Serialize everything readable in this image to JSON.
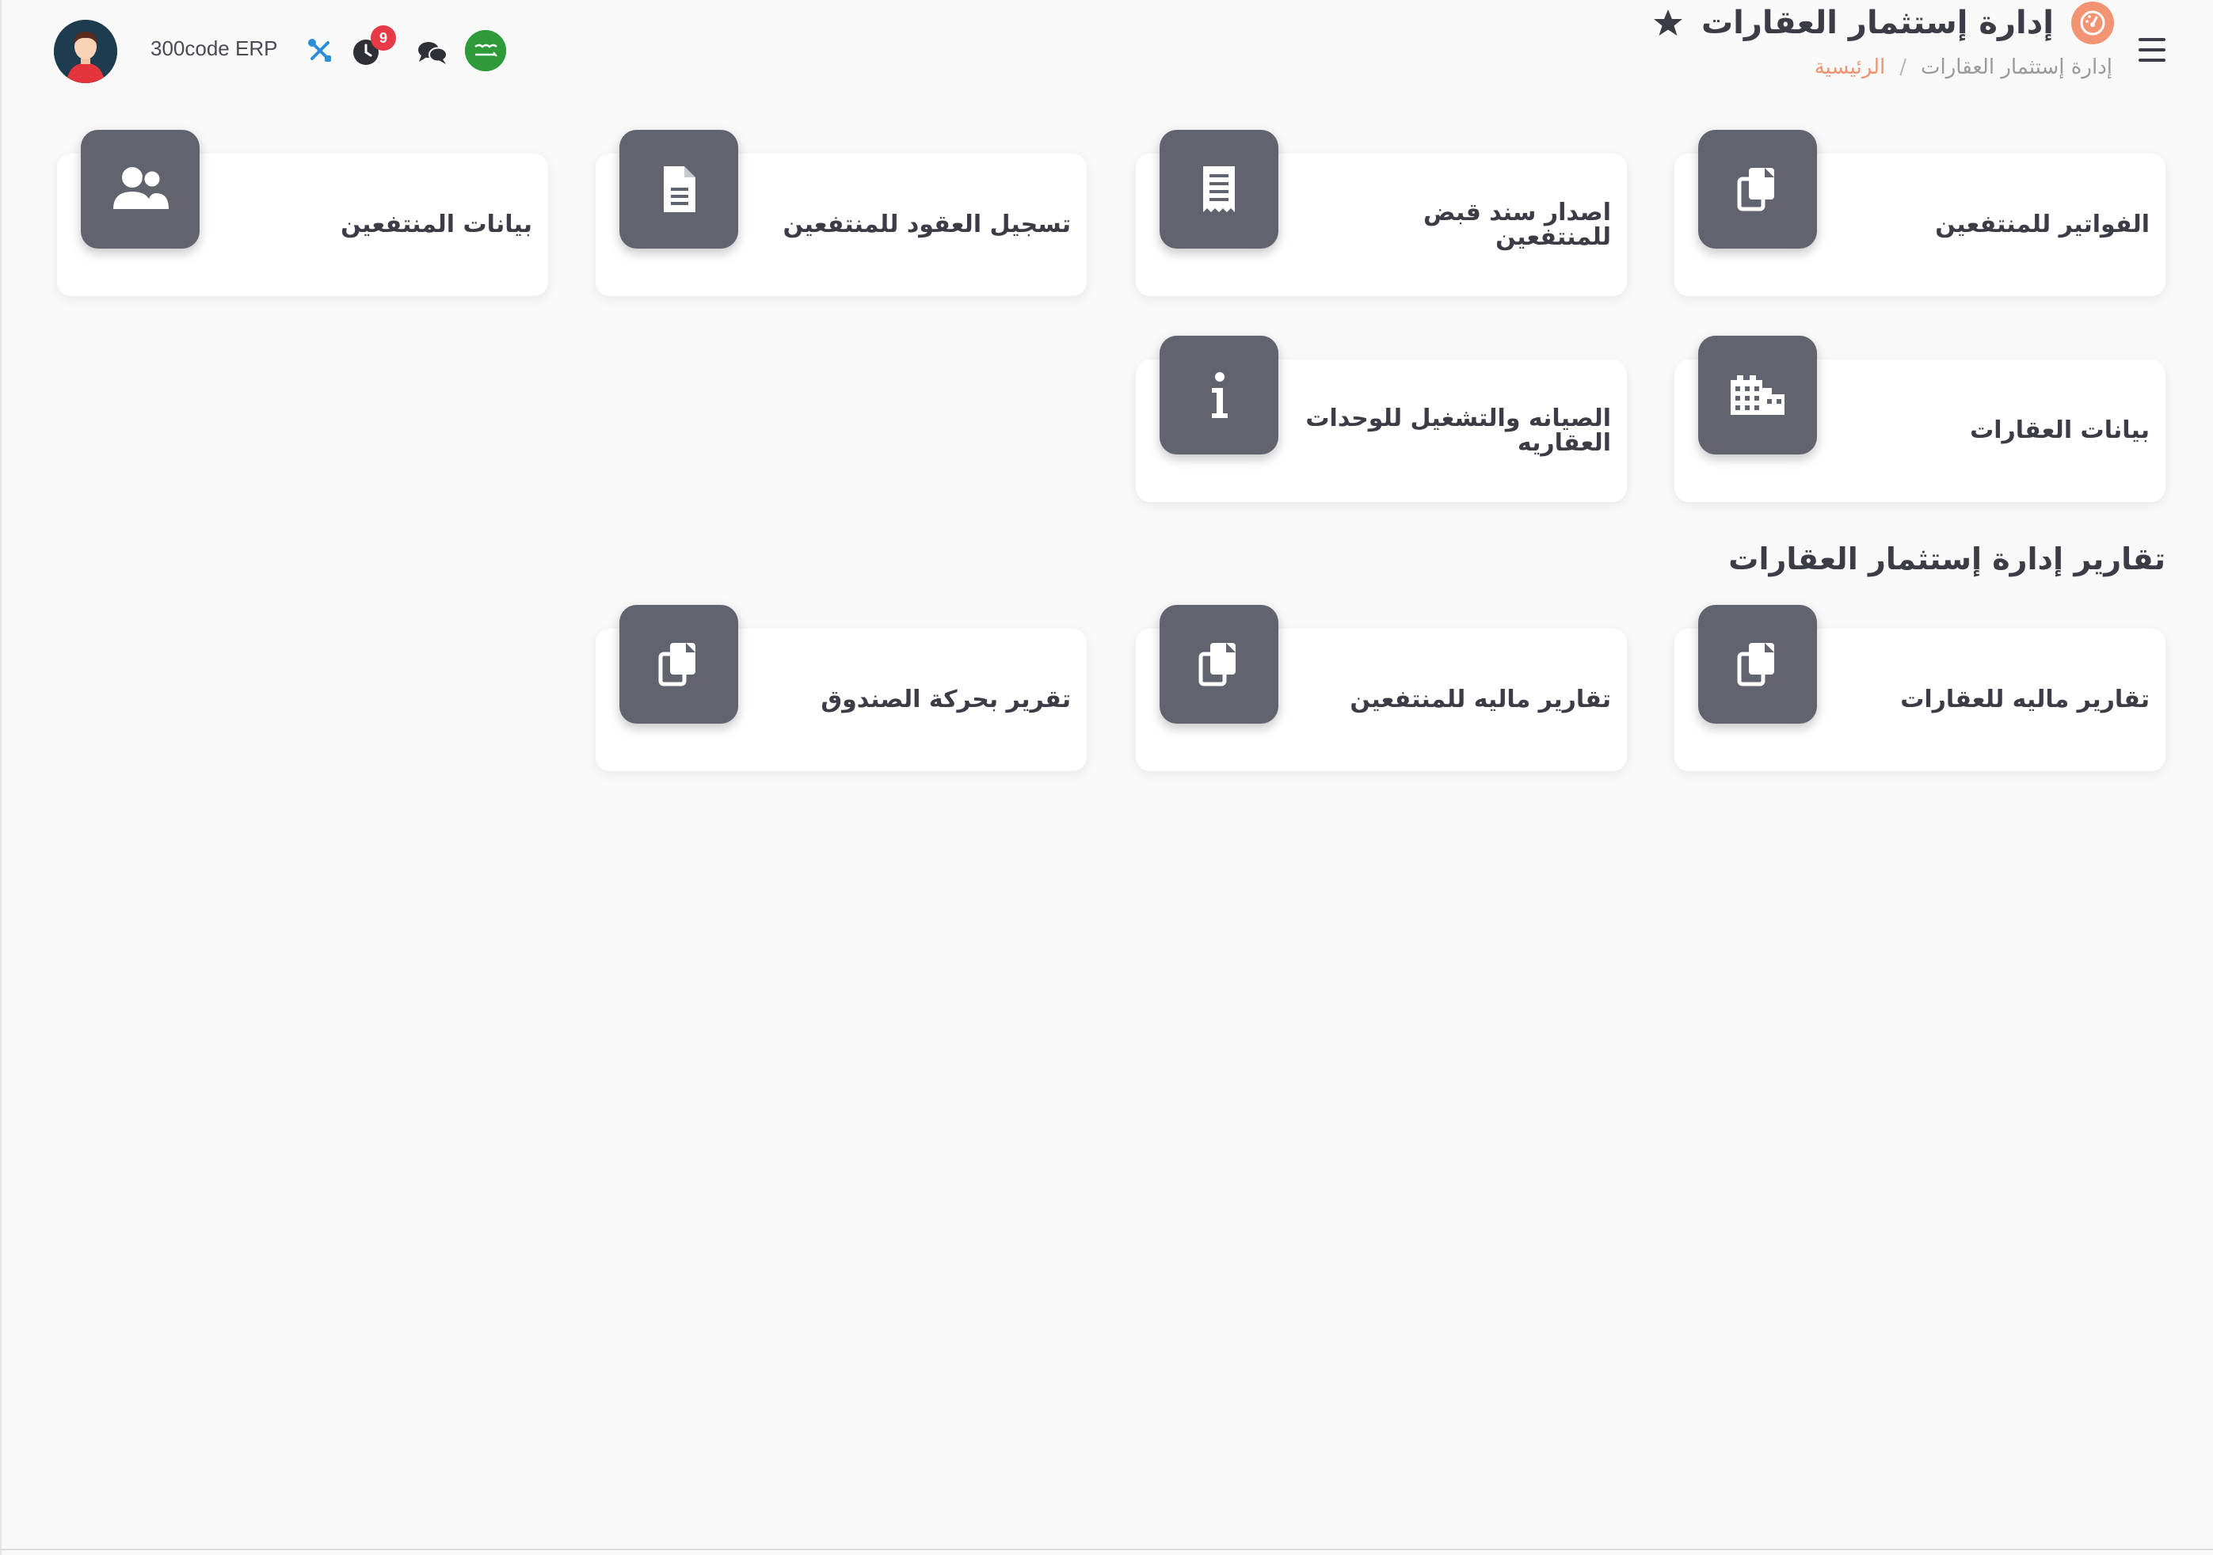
{
  "header": {
    "title": "إدارة إستثمار العقارات",
    "breadcrumb": {
      "home": "الرئيسية",
      "separator": "/",
      "current": "إدارة إستثمار العقارات"
    },
    "brand": "300code ERP",
    "notification_count": "9",
    "accent_color": "#f29474"
  },
  "main_cards": [
    {
      "label": "الفواتير للمنتفعين",
      "icon": "copy-icon"
    },
    {
      "label": "اصدار سند قبض للمنتفعين",
      "icon": "receipt-icon"
    },
    {
      "label": "تسجيل العقود للمنتفعين",
      "icon": "file-icon"
    },
    {
      "label": "بيانات المنتفعين",
      "icon": "users-icon"
    },
    {
      "label": "بيانات العقارات",
      "icon": "building-icon"
    },
    {
      "label": "الصيانه والتشغيل للوحدات العقاريه",
      "icon": "info-icon"
    }
  ],
  "reports": {
    "title": "تقارير إدارة إستثمار العقارات",
    "cards": [
      {
        "label": "تقارير ماليه للعقارات",
        "icon": "copy-icon"
      },
      {
        "label": "تقارير ماليه للمنتفعين",
        "icon": "copy-icon"
      },
      {
        "label": "تقرير بحركة الصندوق",
        "icon": "copy-icon"
      }
    ]
  },
  "colors": {
    "card_icon_bg": "#61636f",
    "notification_badge": "#e83a46",
    "tools_icon": "#2a8fd6"
  }
}
